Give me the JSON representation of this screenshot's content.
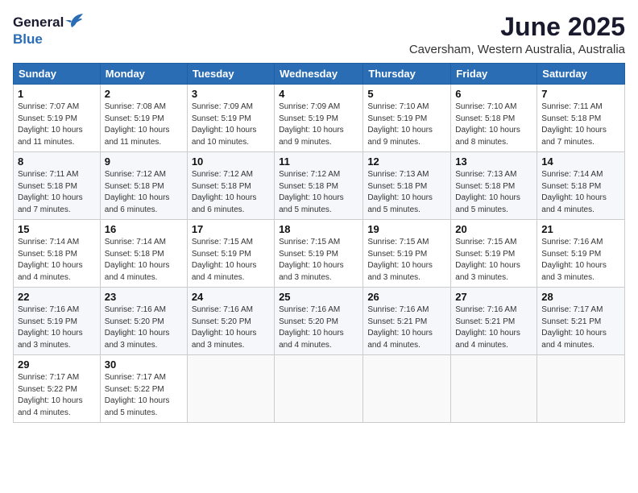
{
  "header": {
    "logo_general": "General",
    "logo_blue": "Blue",
    "month": "June 2025",
    "location": "Caversham, Western Australia, Australia"
  },
  "weekdays": [
    "Sunday",
    "Monday",
    "Tuesday",
    "Wednesday",
    "Thursday",
    "Friday",
    "Saturday"
  ],
  "weeks": [
    [
      {
        "day": "1",
        "info": "Sunrise: 7:07 AM\nSunset: 5:19 PM\nDaylight: 10 hours\nand 11 minutes."
      },
      {
        "day": "2",
        "info": "Sunrise: 7:08 AM\nSunset: 5:19 PM\nDaylight: 10 hours\nand 11 minutes."
      },
      {
        "day": "3",
        "info": "Sunrise: 7:09 AM\nSunset: 5:19 PM\nDaylight: 10 hours\nand 10 minutes."
      },
      {
        "day": "4",
        "info": "Sunrise: 7:09 AM\nSunset: 5:19 PM\nDaylight: 10 hours\nand 9 minutes."
      },
      {
        "day": "5",
        "info": "Sunrise: 7:10 AM\nSunset: 5:19 PM\nDaylight: 10 hours\nand 9 minutes."
      },
      {
        "day": "6",
        "info": "Sunrise: 7:10 AM\nSunset: 5:18 PM\nDaylight: 10 hours\nand 8 minutes."
      },
      {
        "day": "7",
        "info": "Sunrise: 7:11 AM\nSunset: 5:18 PM\nDaylight: 10 hours\nand 7 minutes."
      }
    ],
    [
      {
        "day": "8",
        "info": "Sunrise: 7:11 AM\nSunset: 5:18 PM\nDaylight: 10 hours\nand 7 minutes."
      },
      {
        "day": "9",
        "info": "Sunrise: 7:12 AM\nSunset: 5:18 PM\nDaylight: 10 hours\nand 6 minutes."
      },
      {
        "day": "10",
        "info": "Sunrise: 7:12 AM\nSunset: 5:18 PM\nDaylight: 10 hours\nand 6 minutes."
      },
      {
        "day": "11",
        "info": "Sunrise: 7:12 AM\nSunset: 5:18 PM\nDaylight: 10 hours\nand 5 minutes."
      },
      {
        "day": "12",
        "info": "Sunrise: 7:13 AM\nSunset: 5:18 PM\nDaylight: 10 hours\nand 5 minutes."
      },
      {
        "day": "13",
        "info": "Sunrise: 7:13 AM\nSunset: 5:18 PM\nDaylight: 10 hours\nand 5 minutes."
      },
      {
        "day": "14",
        "info": "Sunrise: 7:14 AM\nSunset: 5:18 PM\nDaylight: 10 hours\nand 4 minutes."
      }
    ],
    [
      {
        "day": "15",
        "info": "Sunrise: 7:14 AM\nSunset: 5:18 PM\nDaylight: 10 hours\nand 4 minutes."
      },
      {
        "day": "16",
        "info": "Sunrise: 7:14 AM\nSunset: 5:18 PM\nDaylight: 10 hours\nand 4 minutes."
      },
      {
        "day": "17",
        "info": "Sunrise: 7:15 AM\nSunset: 5:19 PM\nDaylight: 10 hours\nand 4 minutes."
      },
      {
        "day": "18",
        "info": "Sunrise: 7:15 AM\nSunset: 5:19 PM\nDaylight: 10 hours\nand 3 minutes."
      },
      {
        "day": "19",
        "info": "Sunrise: 7:15 AM\nSunset: 5:19 PM\nDaylight: 10 hours\nand 3 minutes."
      },
      {
        "day": "20",
        "info": "Sunrise: 7:15 AM\nSunset: 5:19 PM\nDaylight: 10 hours\nand 3 minutes."
      },
      {
        "day": "21",
        "info": "Sunrise: 7:16 AM\nSunset: 5:19 PM\nDaylight: 10 hours\nand 3 minutes."
      }
    ],
    [
      {
        "day": "22",
        "info": "Sunrise: 7:16 AM\nSunset: 5:19 PM\nDaylight: 10 hours\nand 3 minutes."
      },
      {
        "day": "23",
        "info": "Sunrise: 7:16 AM\nSunset: 5:20 PM\nDaylight: 10 hours\nand 3 minutes."
      },
      {
        "day": "24",
        "info": "Sunrise: 7:16 AM\nSunset: 5:20 PM\nDaylight: 10 hours\nand 3 minutes."
      },
      {
        "day": "25",
        "info": "Sunrise: 7:16 AM\nSunset: 5:20 PM\nDaylight: 10 hours\nand 4 minutes."
      },
      {
        "day": "26",
        "info": "Sunrise: 7:16 AM\nSunset: 5:21 PM\nDaylight: 10 hours\nand 4 minutes."
      },
      {
        "day": "27",
        "info": "Sunrise: 7:16 AM\nSunset: 5:21 PM\nDaylight: 10 hours\nand 4 minutes."
      },
      {
        "day": "28",
        "info": "Sunrise: 7:17 AM\nSunset: 5:21 PM\nDaylight: 10 hours\nand 4 minutes."
      }
    ],
    [
      {
        "day": "29",
        "info": "Sunrise: 7:17 AM\nSunset: 5:22 PM\nDaylight: 10 hours\nand 4 minutes."
      },
      {
        "day": "30",
        "info": "Sunrise: 7:17 AM\nSunset: 5:22 PM\nDaylight: 10 hours\nand 5 minutes."
      },
      {
        "day": "",
        "info": ""
      },
      {
        "day": "",
        "info": ""
      },
      {
        "day": "",
        "info": ""
      },
      {
        "day": "",
        "info": ""
      },
      {
        "day": "",
        "info": ""
      }
    ]
  ]
}
